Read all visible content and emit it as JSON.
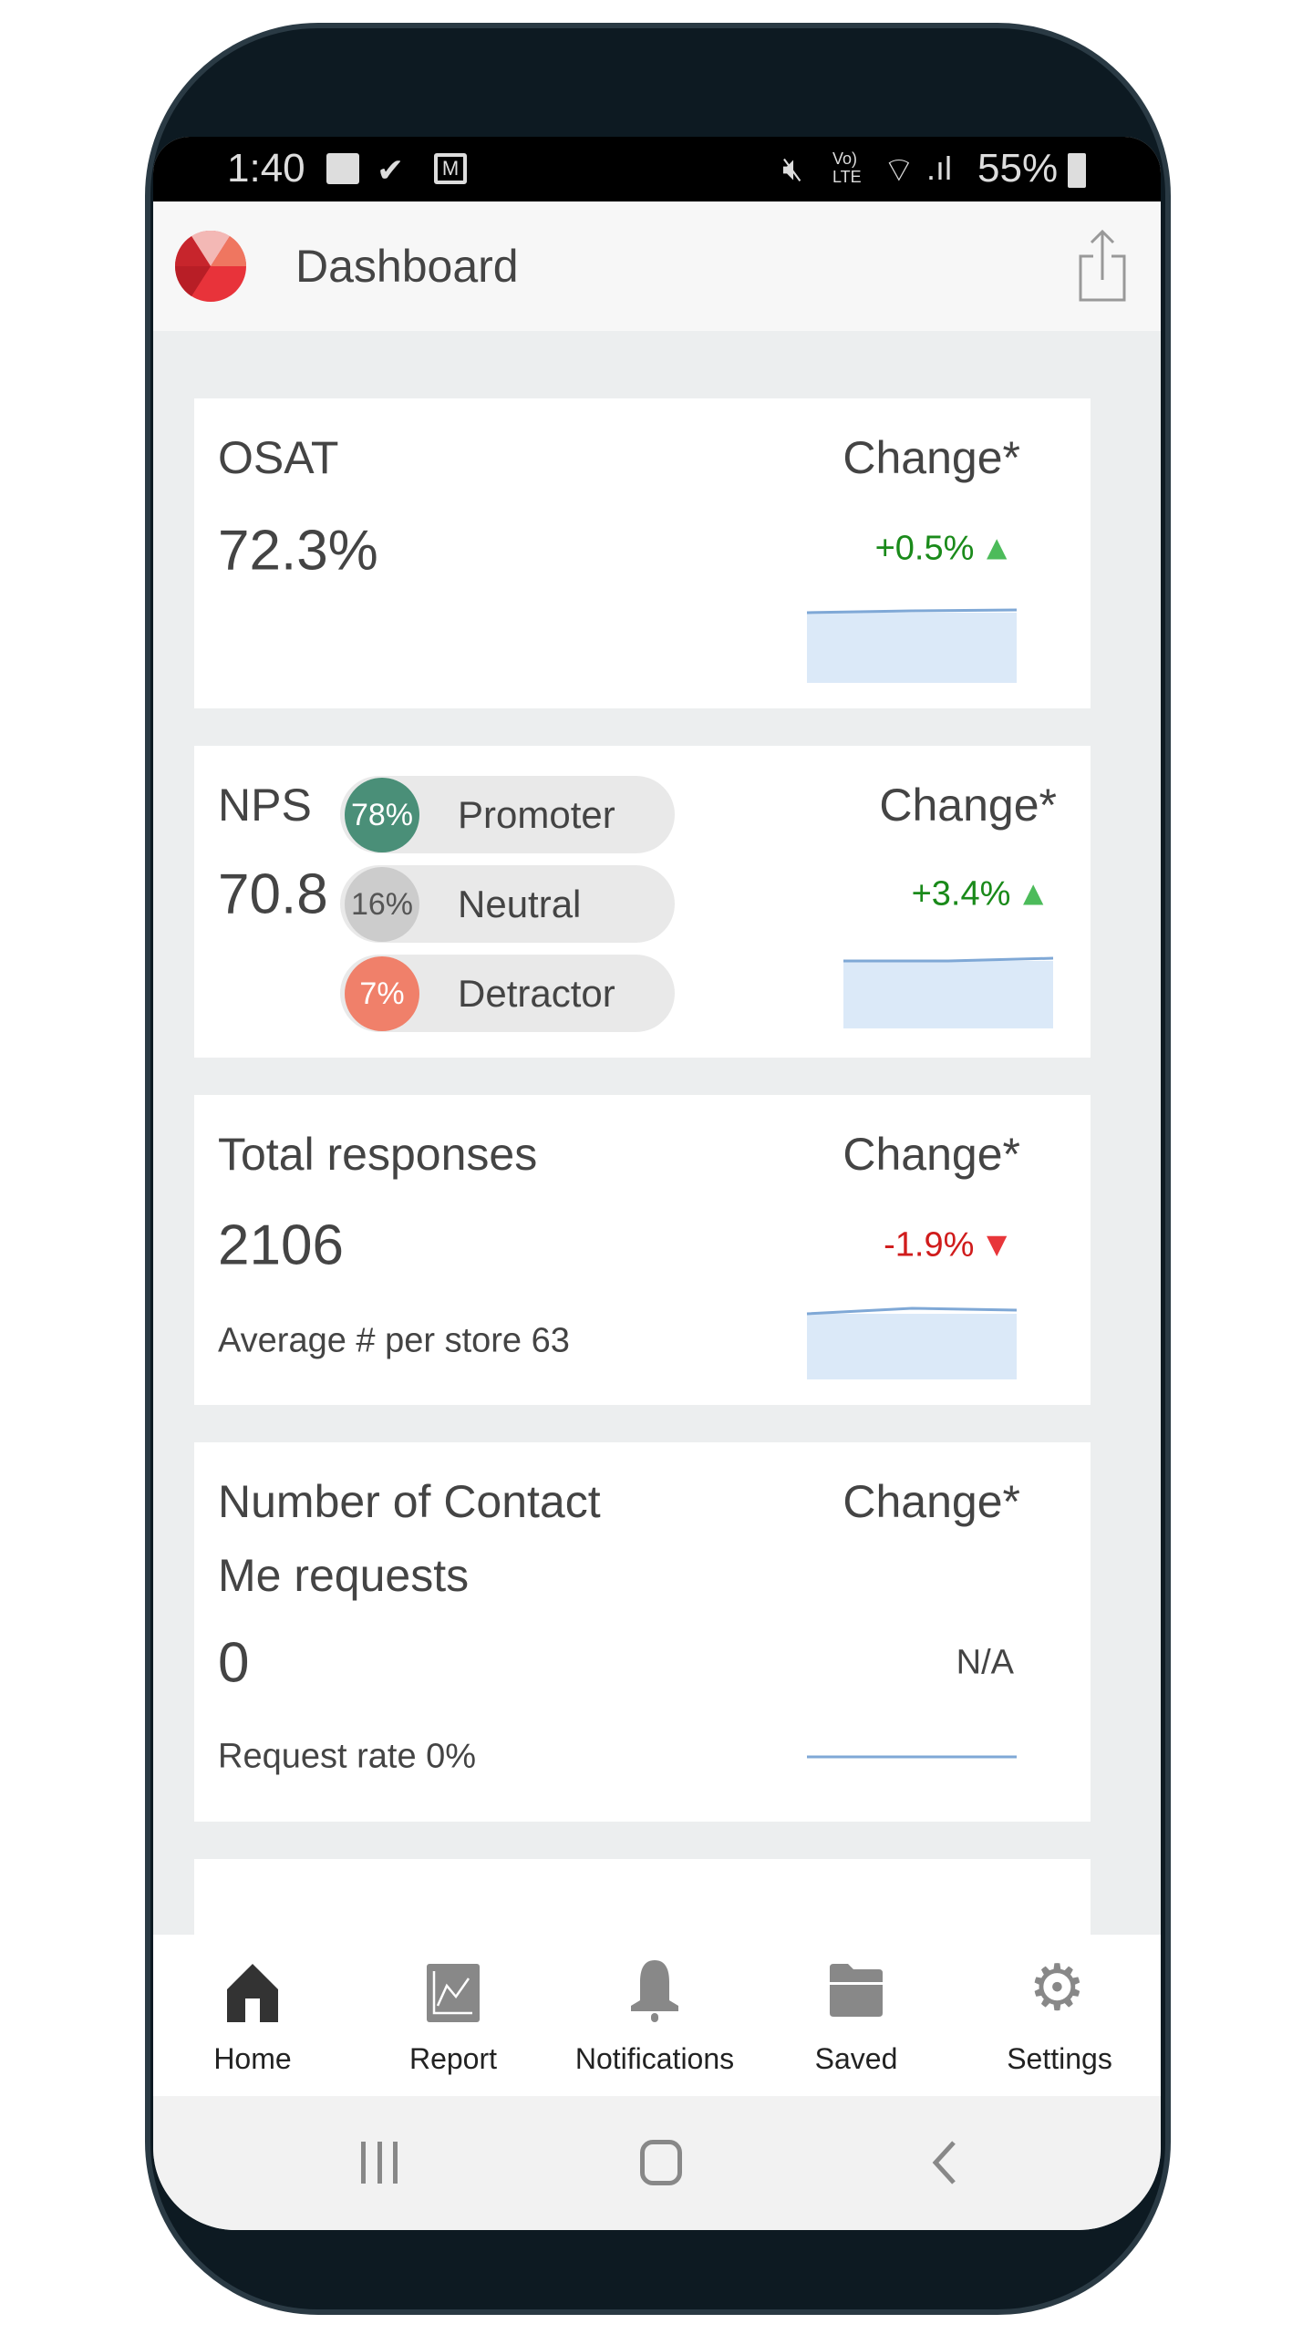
{
  "status_bar": {
    "time": "1:40",
    "battery": "55%",
    "icons": [
      "image-icon",
      "check-icon",
      "gmail-icon",
      "mute-icon",
      "volte-icon",
      "wifi-icon",
      "signal-icon",
      "battery-icon"
    ]
  },
  "header": {
    "title": "Dashboard",
    "share_icon": "share-icon"
  },
  "cards": {
    "osat": {
      "title": "OSAT",
      "value": "72.3%",
      "change_label": "Change*",
      "delta": "+0.5%",
      "direction": "up"
    },
    "nps": {
      "title": "NPS",
      "value": "70.8",
      "change_label": "Change*",
      "delta": "+3.4%",
      "direction": "up",
      "segments": [
        {
          "pct": "78%",
          "label": "Promoter",
          "color": "#4a8f78"
        },
        {
          "pct": "16%",
          "label": "Neutral",
          "color": "#cccccc"
        },
        {
          "pct": "7%",
          "label": "Detractor",
          "color": "#f0806a"
        }
      ]
    },
    "responses": {
      "title": "Total responses",
      "value": "2106",
      "change_label": "Change*",
      "delta": "-1.9%",
      "direction": "down",
      "sub": "Average # per store 63"
    },
    "contact": {
      "title_line1": "Number of Contact",
      "title_line2": "Me requests",
      "value": "0",
      "change_label": "Change*",
      "delta": "N/A",
      "sub": "Request rate 0%"
    }
  },
  "colors": {
    "up": "#1a8a1a",
    "up_arrow": "#4cbb5a",
    "down": "#d01c1c",
    "down_arrow": "#e8363a",
    "spark_fill": "#dbe9f8",
    "spark_line": "#7fa8d6"
  },
  "bottom_nav": [
    {
      "label": "Home",
      "icon": "home-icon"
    },
    {
      "label": "Report",
      "icon": "report-icon"
    },
    {
      "label": "Notifications",
      "icon": "bell-icon"
    },
    {
      "label": "Saved",
      "icon": "folder-icon"
    },
    {
      "label": "Settings",
      "icon": "gear-icon"
    }
  ],
  "system_nav": [
    "recent-apps-icon",
    "home-circle-icon",
    "back-icon"
  ]
}
